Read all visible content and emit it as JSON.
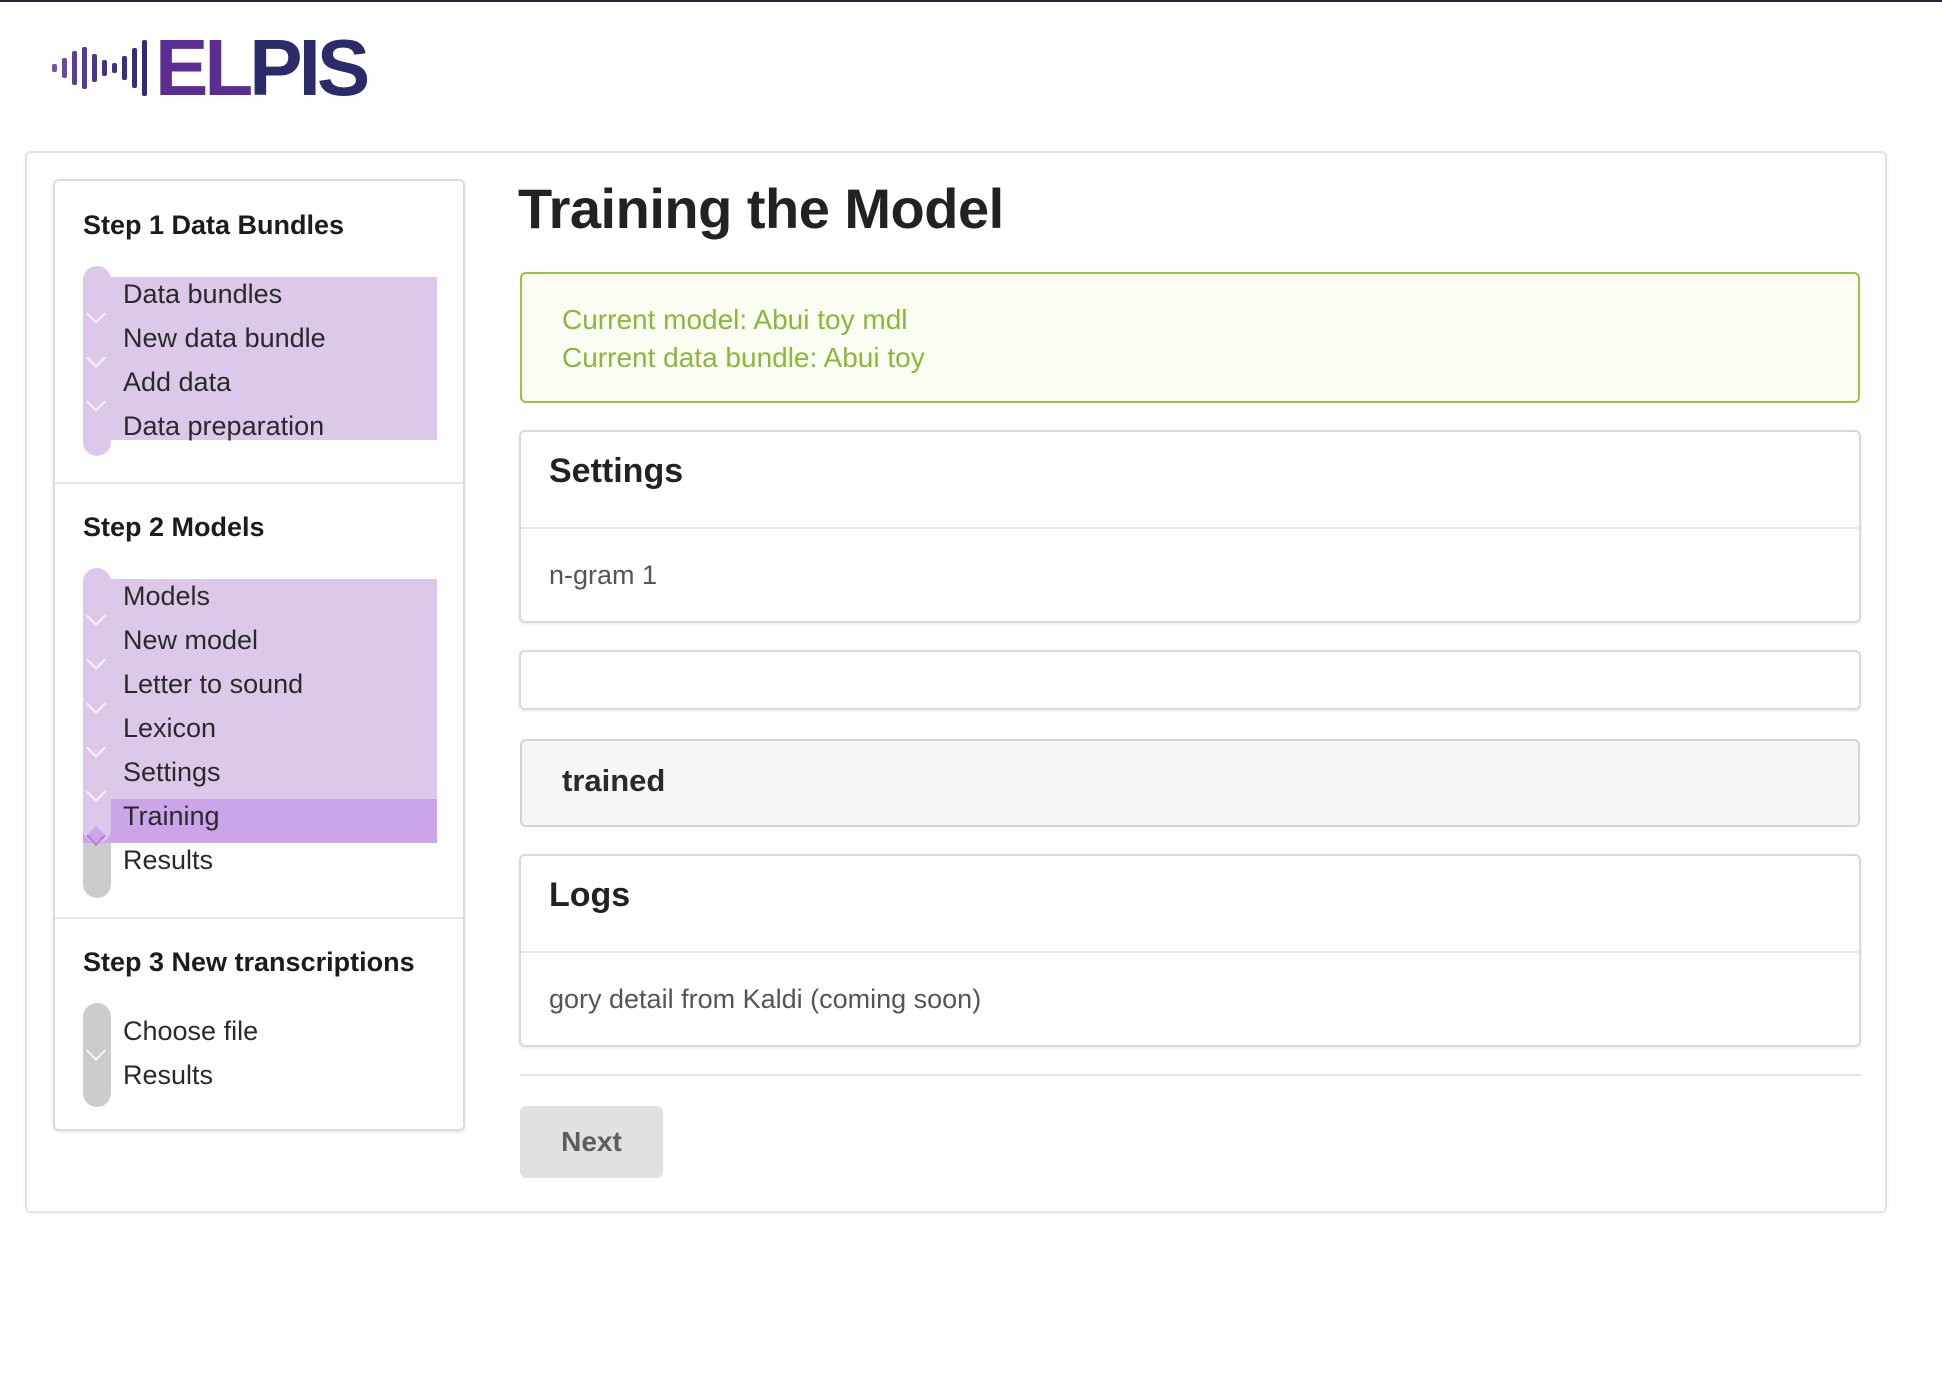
{
  "brand": {
    "logo_text_a": "EL",
    "logo_text_b": "PIS",
    "primary_color": "#2b2a6b",
    "accent_color": "#5b2c91"
  },
  "sidebar": {
    "steps": [
      {
        "title": "Step 1 Data Bundles",
        "items": [
          {
            "label": "Data bundles",
            "state": "done"
          },
          {
            "label": "New data bundle",
            "state": "done"
          },
          {
            "label": "Add data",
            "state": "done"
          },
          {
            "label": "Data preparation",
            "state": "done"
          }
        ]
      },
      {
        "title": "Step 2 Models",
        "items": [
          {
            "label": "Models",
            "state": "done"
          },
          {
            "label": "New model",
            "state": "done"
          },
          {
            "label": "Letter to sound",
            "state": "done"
          },
          {
            "label": "Lexicon",
            "state": "done"
          },
          {
            "label": "Settings",
            "state": "done"
          },
          {
            "label": "Training",
            "state": "active"
          },
          {
            "label": "Results",
            "state": "todo"
          }
        ]
      },
      {
        "title": "Step 3 New transcriptions",
        "items": [
          {
            "label": "Choose file",
            "state": "todo"
          },
          {
            "label": "Results",
            "state": "todo"
          }
        ]
      }
    ],
    "colors": {
      "done": "#dcc9ea",
      "active": "#cba4ea",
      "todo": "#cccccc"
    }
  },
  "main": {
    "title": "Training the Model",
    "alert": {
      "current_model": "Current model: Abui toy mdl",
      "current_bundle": "Current data bundle: Abui toy",
      "color": "#8ab83a"
    },
    "settings_card": {
      "heading": "Settings",
      "body": "n-gram 1"
    },
    "empty_card": {
      "body": ""
    },
    "status": {
      "text": "trained"
    },
    "logs_card": {
      "heading": "Logs",
      "body": "gory detail from Kaldi (coming soon)"
    },
    "next_button": {
      "label": "Next"
    }
  }
}
